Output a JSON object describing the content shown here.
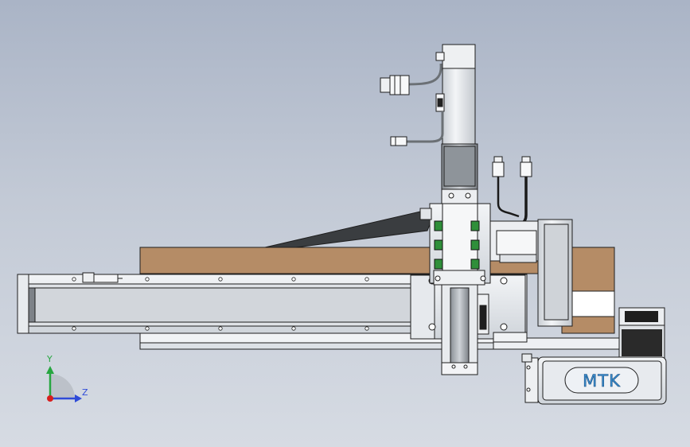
{
  "viewport": {
    "background_top": "#aab4c6",
    "background_bottom": "#d6dbe3"
  },
  "model": {
    "brand_label": "MTK",
    "colors": {
      "metal": "#e4e7ec",
      "metal_dark": "#c7ccd3",
      "wood": "#b58c66",
      "belt": "#3a3d40",
      "cable": "#1a1a1a",
      "bracket_green": "#2f8f3a",
      "brand_text": "#3b8fd0"
    }
  },
  "triad": {
    "y_label": "Y",
    "z_label": "Z",
    "y_color": "#27a640",
    "z_color": "#2f4bd8",
    "x_color": "#d81e1e"
  }
}
